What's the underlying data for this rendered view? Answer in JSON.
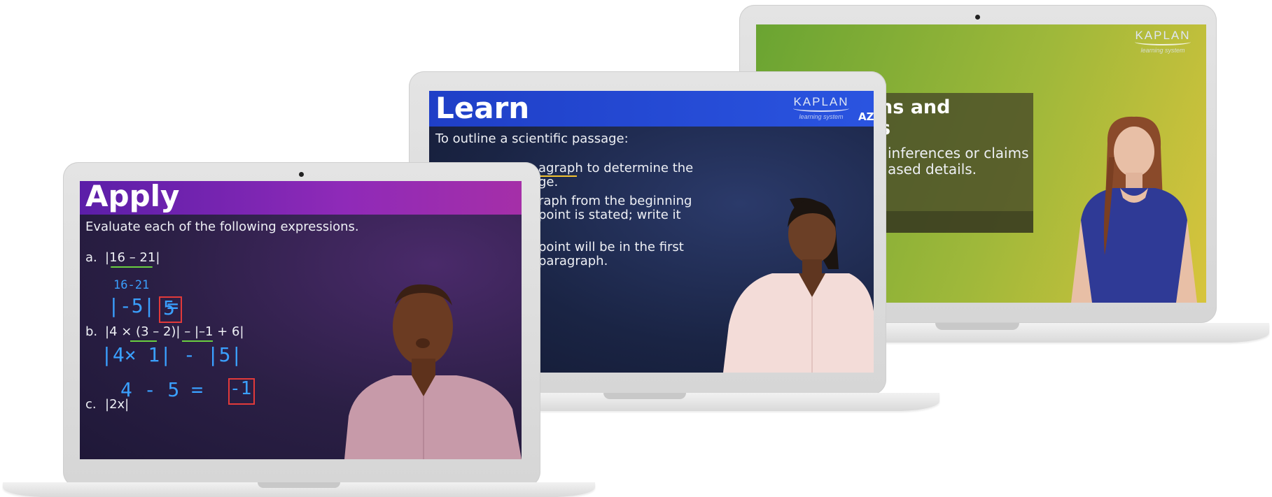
{
  "laptops": {
    "right": {
      "logo": "KAPLAN",
      "logo_sub": "learning system",
      "overlay_title_1": "ns and",
      "overlay_title_2": "s",
      "overlay_line_1": "inferences or claims",
      "overlay_line_2": "ased details."
    },
    "middle": {
      "title": "Learn",
      "logo": "KAPLAN",
      "logo_sub": "learning system",
      "partner": "AZ",
      "intro": "To outline a scientific passage:",
      "line_1": "agraph to determine the",
      "line_2": "ge.",
      "line_3": "raph from the beginning",
      "line_4": "point is stated; write it",
      "line_5": "point will be in the first",
      "line_6": "paragraph."
    },
    "left": {
      "title": "Apply",
      "instruction": "Evaluate each of the following expressions.",
      "item_a_label": "a.",
      "item_a_expr": "|16 – 21|",
      "item_b_label": "b.",
      "item_b_expr": "|4 × (3 – 2)| – |–1 + 6|",
      "item_c_label": "c.",
      "item_c_expr": "|2x|",
      "hw_a_1": "16-21",
      "hw_a_2": "|-5| =",
      "hw_a_ans": "5",
      "hw_b_1": "|4× 1|  -  |5|",
      "hw_b_2": "4    -   5  =",
      "hw_b_ans": "-1"
    }
  },
  "colors": {
    "right_bg_start": "#6fa832",
    "right_bg_end": "#d8c23a",
    "middle_header": "#1d3ed0",
    "middle_bg": "#1b2543",
    "left_header": "#7a23b0",
    "left_bg": "#2a1e44",
    "handwriting": "#3aa0ff",
    "answer_box": "#e23a3a"
  }
}
